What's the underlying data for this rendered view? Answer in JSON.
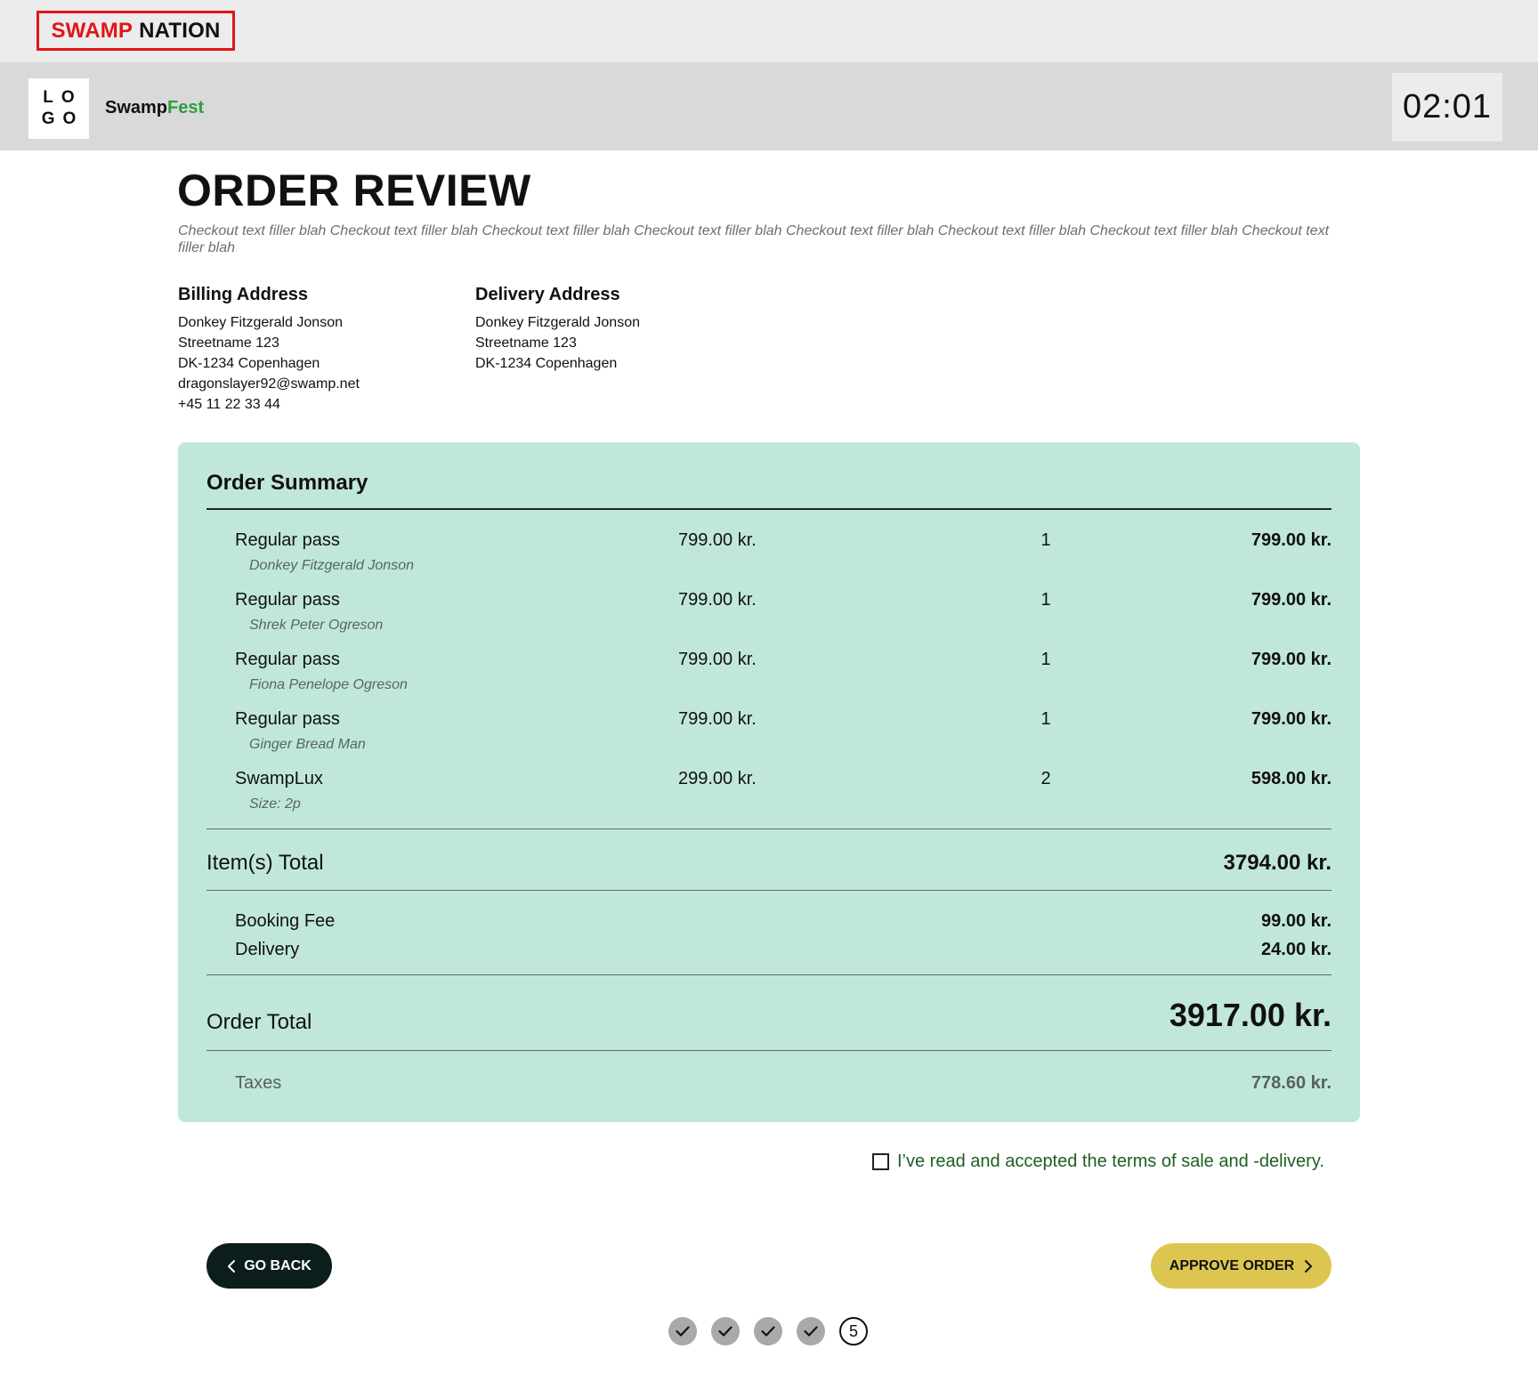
{
  "brand": {
    "part1": "SWAMP",
    "part2": "NATION"
  },
  "header": {
    "logo_line1": "LO",
    "logo_line2": "GO",
    "site_part1": "Swamp",
    "site_part2": "Fest",
    "timer": "02:01"
  },
  "page": {
    "title": "ORDER REVIEW",
    "subtitle": "Checkout text filler blah Checkout text filler blah Checkout text filler blah Checkout text filler blah Checkout text filler blah Checkout text filler blah Checkout text filler blah Checkout text filler blah"
  },
  "billing": {
    "heading": "Billing Address",
    "name": "Donkey Fitzgerald Jonson",
    "street": "Streetname 123",
    "city": "DK-1234 Copenhagen",
    "email": "dragonslayer92@swamp.net",
    "phone": "+45 11 22 33 44"
  },
  "delivery": {
    "heading": "Delivery Address",
    "name": "Donkey Fitzgerald Jonson",
    "street": "Streetname 123",
    "city": "DK-1234 Copenhagen"
  },
  "summary": {
    "heading": "Order Summary",
    "items": [
      {
        "name": "Regular pass",
        "sub": "Donkey Fitzgerald Jonson",
        "price": "799.00 kr.",
        "qty": "1",
        "total": "799.00 kr."
      },
      {
        "name": "Regular pass",
        "sub": "Shrek Peter Ogreson",
        "price": "799.00 kr.",
        "qty": "1",
        "total": "799.00 kr."
      },
      {
        "name": "Regular pass",
        "sub": "Fiona Penelope Ogreson",
        "price": "799.00 kr.",
        "qty": "1",
        "total": "799.00 kr."
      },
      {
        "name": "Regular pass",
        "sub": "Ginger Bread Man",
        "price": "799.00 kr.",
        "qty": "1",
        "total": "799.00 kr."
      },
      {
        "name": "SwampLux",
        "sub": "Size: 2p",
        "price": "299.00 kr.",
        "qty": "2",
        "total": "598.00 kr."
      }
    ],
    "items_total_label": "Item(s) Total",
    "items_total_value": "3794.00 kr.",
    "booking_fee_label": "Booking Fee",
    "booking_fee_value": "99.00 kr.",
    "delivery_label": "Delivery",
    "delivery_value": "24.00 kr.",
    "order_total_label": "Order Total",
    "order_total_value": "3917.00 kr.",
    "taxes_label": "Taxes",
    "taxes_value": "778.60 kr."
  },
  "terms": {
    "label": "I’ve read and accepted the terms of sale and -delivery.",
    "checked": false
  },
  "buttons": {
    "back": "GO BACK",
    "approve": "APPROVE ORDER"
  },
  "steps": {
    "current": "5",
    "completed": 4
  },
  "colors": {
    "brand_red": "#e01616",
    "fest_green": "#2e9e3c",
    "summary_bg": "#c1e7db",
    "back_button": "#0b1e1c",
    "approve_button": "#ddc650",
    "terms_text": "#1d5e24"
  }
}
